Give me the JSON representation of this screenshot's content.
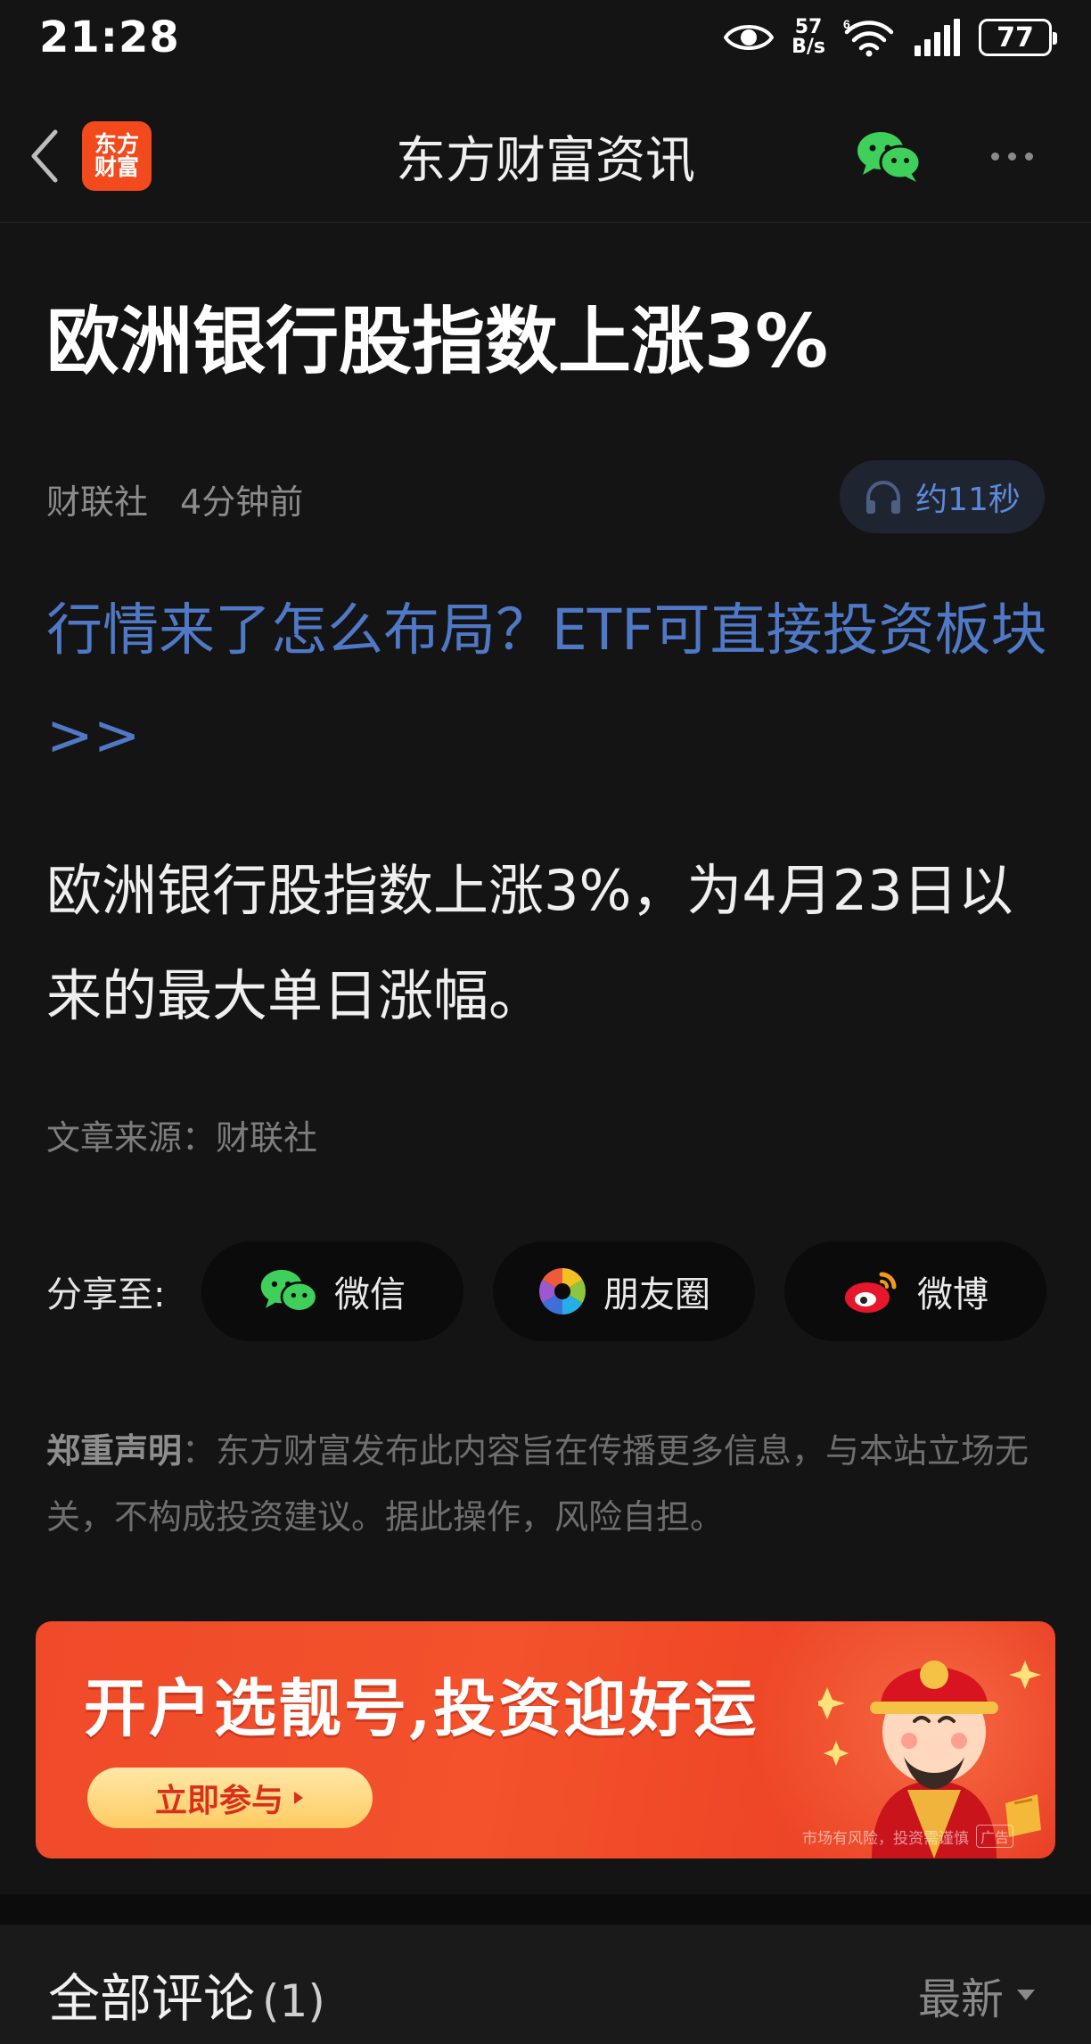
{
  "status_bar": {
    "time": "21:28",
    "net_speed_value": "57",
    "net_speed_unit": "B/s",
    "wifi_label": "6",
    "battery": "77"
  },
  "nav": {
    "logo_line1": "东方",
    "logo_line2": "财富",
    "title": "东方财富资讯"
  },
  "article": {
    "headline": "欧洲银行股指数上涨3%",
    "source_name": "财联社",
    "time_ago": "4分钟前",
    "audio_duration": "约11秒",
    "promo_link": "行情来了怎么布局？ETF可直接投资板块>>",
    "body": "欧洲银行股指数上涨3%，为4月23日以来的最大单日涨幅。",
    "source_line": "文章来源：财联社"
  },
  "share": {
    "label": "分享至:",
    "wechat": "微信",
    "moments": "朋友圈",
    "weibo": "微博"
  },
  "disclaimer": {
    "title": "郑重声明",
    "text": "：东方财富发布此内容旨在传播更多信息，与本站立场无关，不构成投资建议。据此操作，风险自担。"
  },
  "ad": {
    "headline": "开户选靓号,投资迎好运",
    "cta": "立即参与",
    "footnote": "市场有风险，投资需谨慎",
    "tag": "广告"
  },
  "comments": {
    "title": "全部评论",
    "count": "(1)",
    "sort": "最新"
  },
  "colors": {
    "background": "#141414",
    "link_blue": "#4f79c6",
    "brand_orange": "#f24a1d",
    "wechat_green": "#3fcf5b",
    "ad_red": "#ef4a2a"
  },
  "icons": [
    "back-icon",
    "wechat-icon",
    "more-icon",
    "headphones-icon",
    "moments-icon",
    "weibo-icon",
    "chevron-down-icon",
    "eye-icon",
    "wifi-icon",
    "signal-icon"
  ]
}
